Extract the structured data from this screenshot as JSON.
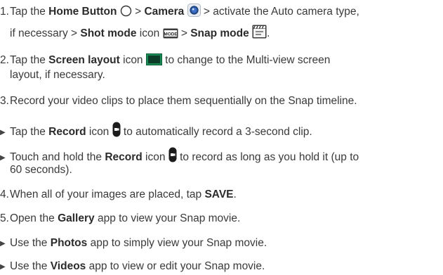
{
  "steps": {
    "s1": {
      "num": "1.",
      "t1": "Tap the ",
      "home": "Home Button",
      "t2": " > ",
      "camera": "Camera",
      "t3": " > activate the Auto camera type,",
      "t4": "if necessary > ",
      "shot": "Shot mode",
      "t5": " icon ",
      "t6": " > ",
      "snap": "Snap mode",
      "t7": ".",
      "mode_icon_text": "MODE"
    },
    "s2": {
      "num": "2.",
      "t1": "Tap the ",
      "screen": "Screen layout",
      "t2": " icon ",
      "t3": " to change to the Multi-view screen",
      "t4": "layout, if necessary."
    },
    "s3": {
      "num": "3.",
      "t1": "Record your video clips to place them sequentially on the Snap timeline."
    },
    "b1": {
      "t1": "Tap the ",
      "record": "Record",
      "t2": " icon ",
      "t3": " to automatically record a 3-second clip."
    },
    "b2": {
      "t1": "Touch and hold the ",
      "record": "Record",
      "t2": " icon ",
      "t3": " to record as long as you hold it (up to",
      "t4": "60 seconds)."
    },
    "s4": {
      "num": "4.",
      "t1": "When all of your images are placed, tap ",
      "save": "SAVE",
      "t2": "."
    },
    "s5": {
      "num": "5.",
      "t1": "Open the ",
      "gallery": "Gallery",
      "t2": " app to view your Snap movie."
    },
    "b3": {
      "t1": "Use the ",
      "photos": "Photos",
      "t2": " app to simply view your Snap movie."
    },
    "b4": {
      "t1": "Use the ",
      "videos": "Videos",
      "t2": " app to view or edit your Snap movie."
    }
  },
  "bullet_glyph": "▶",
  "colors": {
    "text": "#3a3a3a",
    "screen_layout_icon": "#1a8a55",
    "camera_icon": "#3a6ec8",
    "record_icon": "#1c1c1c"
  },
  "icons": {
    "home": "home-button-icon",
    "camera": "camera-app-icon",
    "mode": "shot-mode-icon",
    "snap": "snap-mode-icon",
    "screen": "screen-layout-icon",
    "record": "record-icon"
  }
}
